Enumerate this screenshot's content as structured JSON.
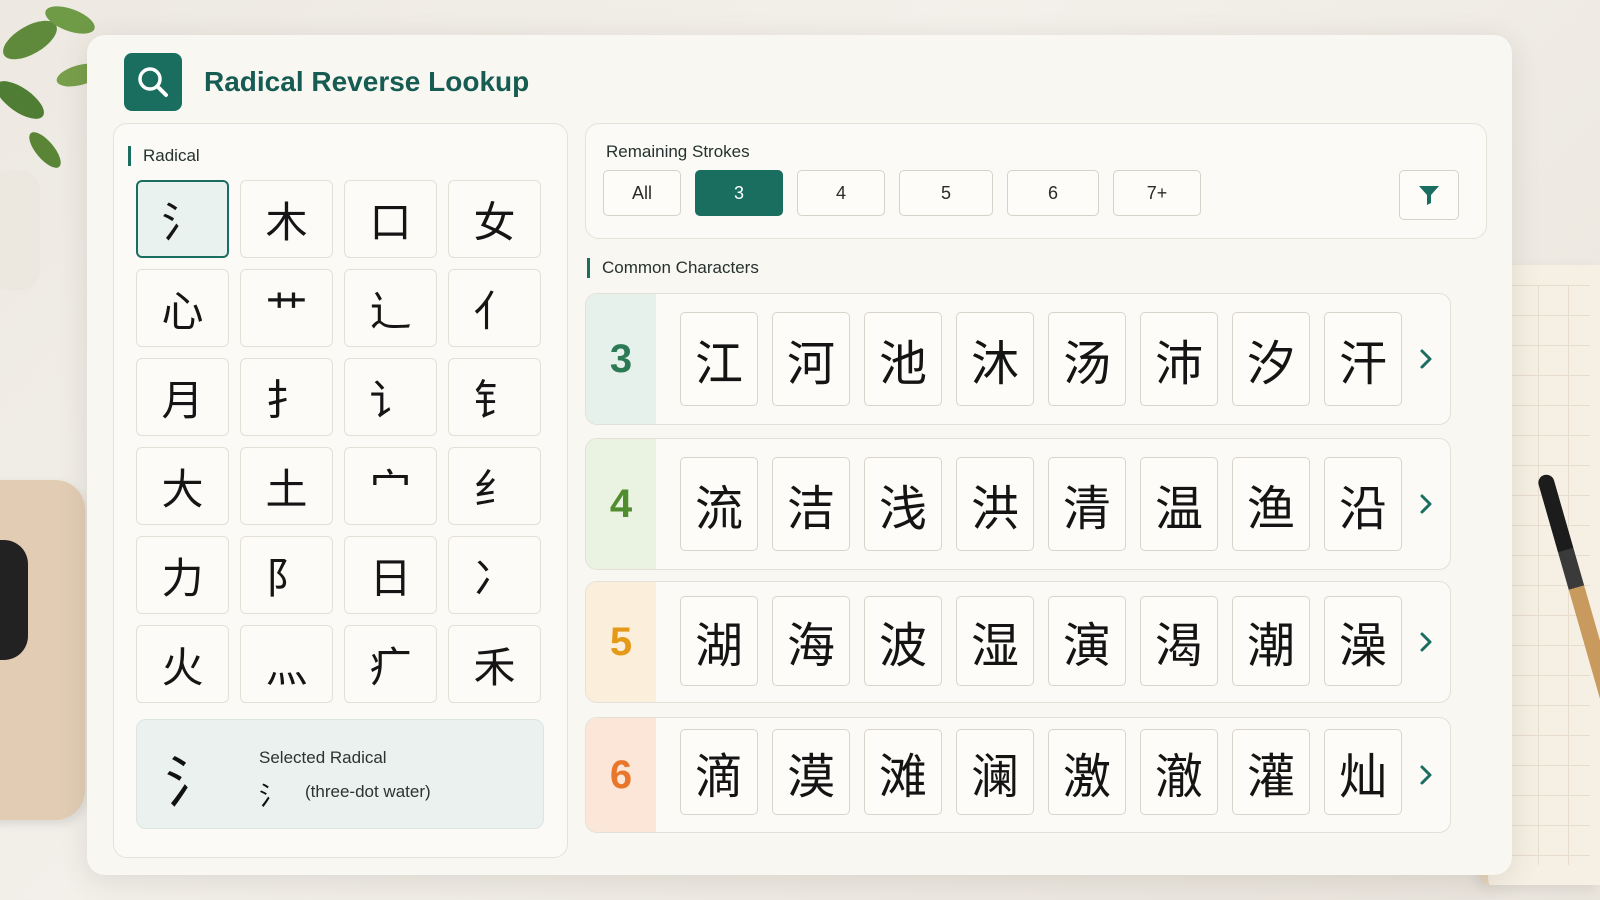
{
  "header": {
    "title": "Radical Reverse Lookup",
    "icon": "search-icon"
  },
  "radical_panel": {
    "label": "Radical",
    "radicals": [
      "氵",
      "木",
      "口",
      "女",
      "心",
      "艹",
      "辶",
      "亻",
      "月",
      "扌",
      "讠",
      "钅",
      "大",
      "土",
      "宀",
      "纟",
      "力",
      "阝",
      "日",
      "冫",
      "火",
      "灬",
      "疒",
      "禾"
    ],
    "selected_index": 0,
    "selected": {
      "label": "Selected Radical",
      "big": "氵",
      "small": "氵",
      "description": "(three-dot water)"
    }
  },
  "strokes": {
    "label": "Remaining Strokes",
    "options": [
      "All",
      "3",
      "4",
      "5",
      "6",
      "7+"
    ],
    "active": "3",
    "filter_icon": "filter-icon"
  },
  "common": {
    "label": "Common Characters",
    "rows": [
      {
        "strokes": "3",
        "color": "#2b7a55",
        "bg": "#e7f1ec",
        "chars": [
          "江",
          "河",
          "池",
          "沐",
          "汤",
          "沛",
          "汐",
          "汗"
        ]
      },
      {
        "strokes": "4",
        "color": "#4f8d2e",
        "bg": "#eaf2e1",
        "chars": [
          "流",
          "洁",
          "浅",
          "洪",
          "清",
          "温",
          "渔",
          "沿"
        ]
      },
      {
        "strokes": "5",
        "color": "#e49a18",
        "bg": "#fbeedb",
        "chars": [
          "湖",
          "海",
          "波",
          "湿",
          "演",
          "渴",
          "潮",
          "澡"
        ]
      },
      {
        "strokes": "6",
        "color": "#e8762b",
        "bg": "#fbe6d8",
        "chars": [
          "滴",
          "漠",
          "滩",
          "澜",
          "激",
          "澈",
          "灌",
          "灿"
        ]
      }
    ],
    "arrow_icon": "chevron-right-icon",
    "accent": "#1a6e60"
  }
}
